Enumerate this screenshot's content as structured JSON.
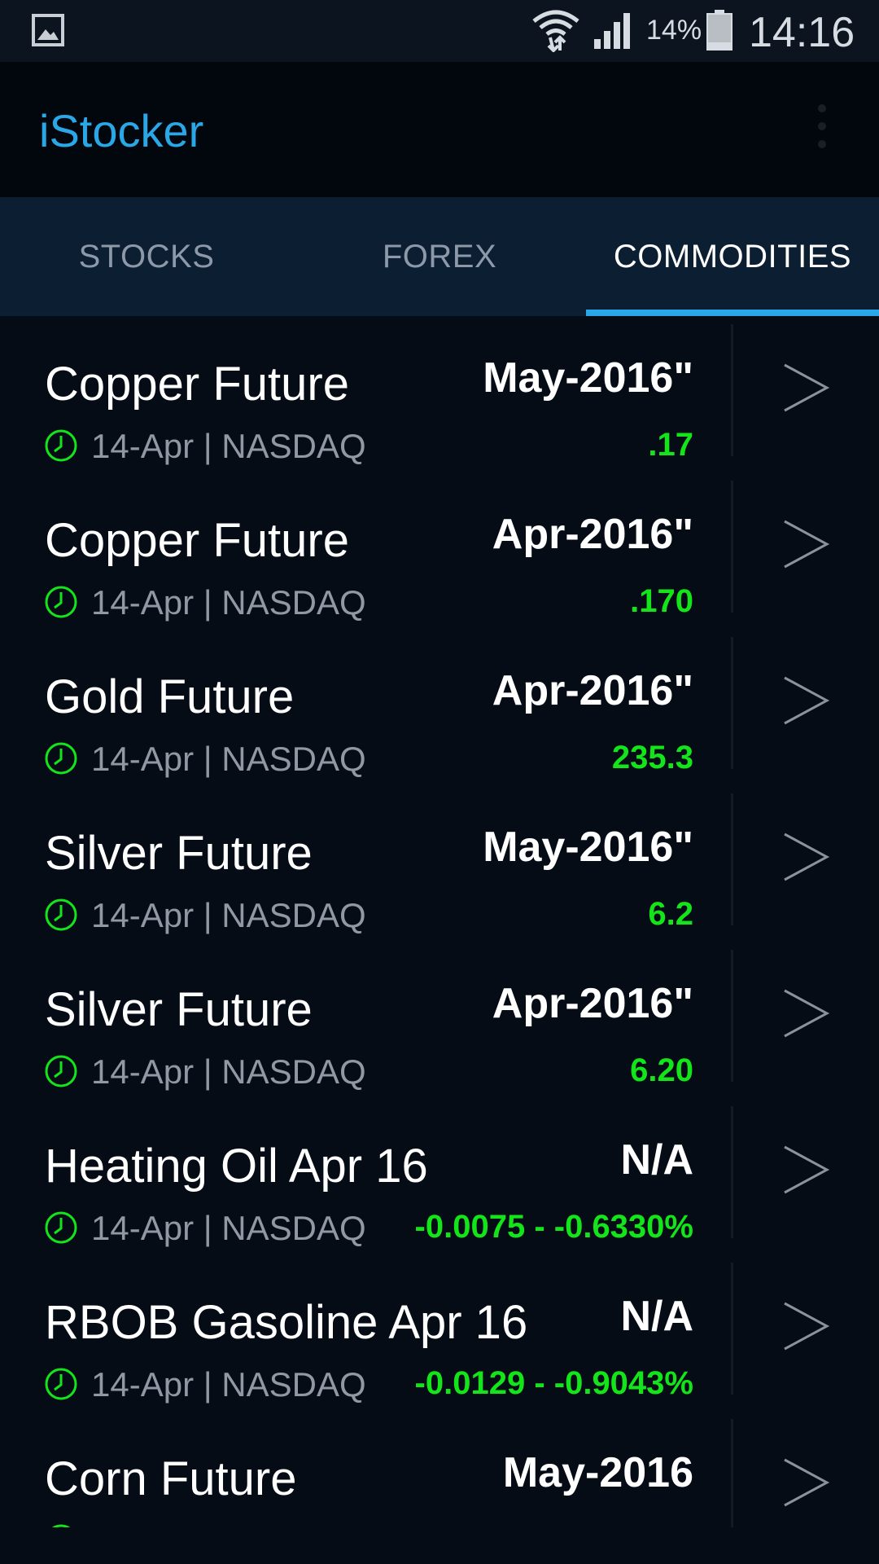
{
  "status_bar": {
    "battery": "14%",
    "time": "14:16",
    "icons": [
      "gallery-icon",
      "wifi-icon",
      "signal-icon",
      "battery-icon"
    ]
  },
  "app_bar": {
    "title": "iStocker",
    "menu_icon": "overflow-menu-icon"
  },
  "tabs": [
    {
      "label": "STOCKS",
      "active": false
    },
    {
      "label": "FOREX",
      "active": false
    },
    {
      "label": "COMMODITIES",
      "active": true
    }
  ],
  "colors": {
    "accent": "#2aa7e6",
    "positive": "#13e51a",
    "background": "#050c16"
  },
  "rows": [
    {
      "name": "Copper Future",
      "contract": "May-2016\"",
      "meta": "14-Apr | NASDAQ",
      "change": ".17"
    },
    {
      "name": "Copper Future",
      "contract": "Apr-2016\"",
      "meta": "14-Apr | NASDAQ",
      "change": ".170"
    },
    {
      "name": "Gold Future",
      "contract": "Apr-2016\"",
      "meta": "14-Apr | NASDAQ",
      "change": "235.3"
    },
    {
      "name": "Silver Future",
      "contract": "May-2016\"",
      "meta": "14-Apr | NASDAQ",
      "change": "6.2"
    },
    {
      "name": "Silver Future",
      "contract": "Apr-2016\"",
      "meta": "14-Apr | NASDAQ",
      "change": "6.20"
    },
    {
      "name": "Heating Oil Apr 16",
      "contract": "N/A",
      "meta": "14-Apr | NASDAQ",
      "change": "-0.0075 - -0.6330%"
    },
    {
      "name": "RBOB Gasoline Apr 16",
      "contract": "N/A",
      "meta": "14-Apr | NASDAQ",
      "change": "-0.0129 - -0.9043%"
    },
    {
      "name": "Corn Future",
      "contract": "May-2016",
      "meta": "",
      "change": ""
    }
  ]
}
